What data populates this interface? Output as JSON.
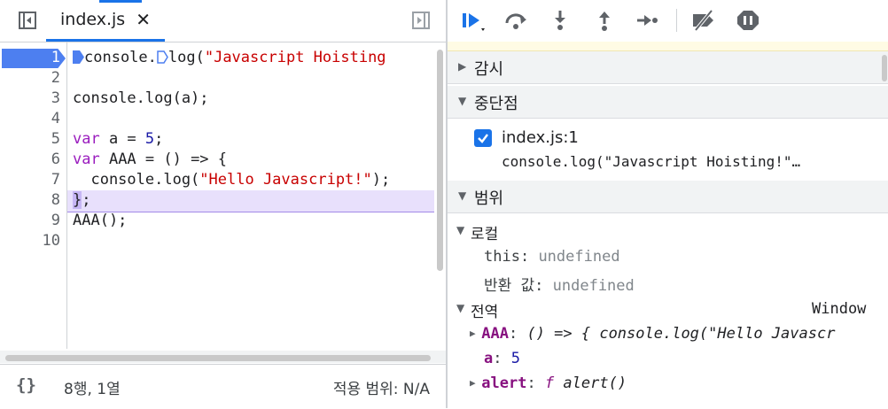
{
  "source_tab": {
    "filename": "index.js",
    "close_glyph": "✕"
  },
  "gutter": {
    "line_numbers": [
      "1",
      "2",
      "3",
      "4",
      "5",
      "6",
      "7",
      "8",
      "9",
      "10"
    ],
    "breakpoint_line": "1"
  },
  "code": {
    "l1_a": "console.",
    "l1_b": "log(",
    "l1_str": "\"Javascript Hoisting",
    "l3": "console.log(a);",
    "l5_kw": "var",
    "l5_rest": " a = ",
    "l5_num": "5",
    "l5_end": ";",
    "l6_kw": "var",
    "l6_rest": " AAA = () => {",
    "l7_a": "  console.log(",
    "l7_str": "\"Hello Javascript!\"",
    "l7_end": ");",
    "l8_a": "}",
    "l8_b": ";",
    "l9": "AAA();"
  },
  "statusbar": {
    "braces": "{}",
    "cursor": "8행, 1열",
    "scope": "적용 범위: N/A"
  },
  "sections": {
    "watch": "감시",
    "breakpoints": "중단점",
    "scope": "범위"
  },
  "breakpoint_item": {
    "checked": true,
    "file": "index.js:1",
    "code": "console.log(\"Javascript Hoisting!\"…"
  },
  "scope": {
    "local": {
      "label": "로컬",
      "this_name": "this",
      "this_value": "undefined",
      "return_name": "반환 값",
      "return_value": "undefined"
    },
    "global": {
      "label": "전역",
      "value": "Window",
      "aaa_name": "AAA",
      "aaa_value": "() => { console.log(\"Hello Javascr",
      "a_name": "a",
      "a_value": "5",
      "alert_name": "alert",
      "alert_f": "f",
      "alert_value": "alert()"
    }
  },
  "colors": {
    "accent": "#1a73e8",
    "breakpoint": "#4d7ff0",
    "current_line": "#e8e0fc",
    "keyword": "#9a1cbe",
    "string": "#c80000",
    "number": "#1a1aa6"
  },
  "icons": {
    "toggle_navigator": "sidebar-left-icon",
    "toggle_debugger": "sidebar-right-icon",
    "resume": "resume-icon",
    "step_over": "step-over-icon",
    "step_into": "step-into-icon",
    "step_out": "step-out-icon",
    "step": "step-icon",
    "deactivate": "deactivate-breakpoints-icon",
    "pause_exceptions": "pause-on-exceptions-icon"
  }
}
